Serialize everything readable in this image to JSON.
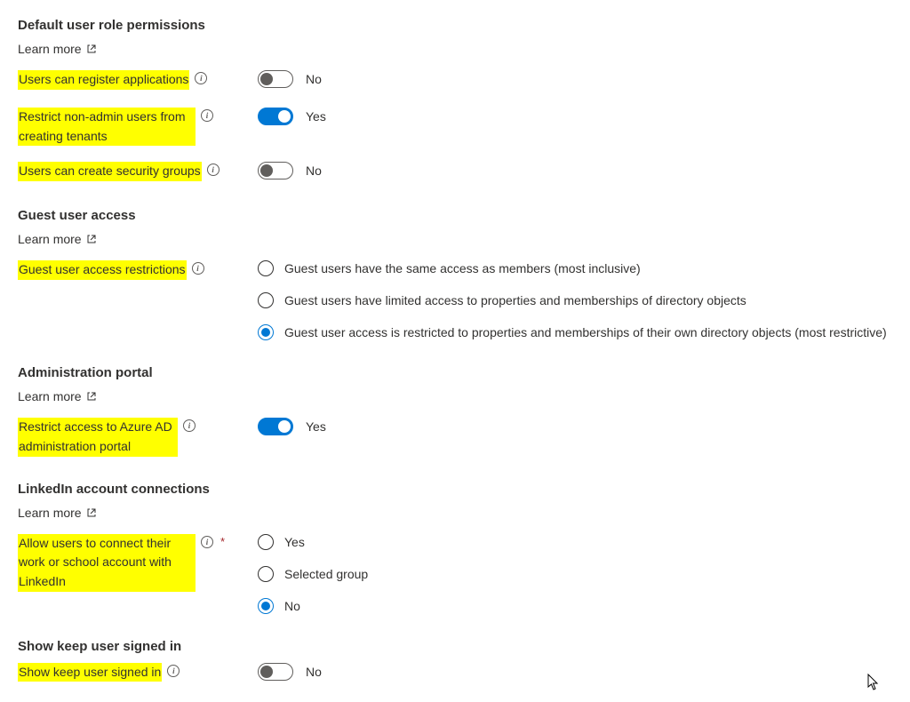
{
  "sections": {
    "default_role": {
      "title": "Default user role permissions",
      "learn_more": "Learn more",
      "settings": {
        "register_apps": {
          "label": "Users can register applications",
          "value": "No",
          "on": false
        },
        "restrict_tenants": {
          "label": "Restrict non-admin users from creating tenants",
          "value": "Yes",
          "on": true
        },
        "security_groups": {
          "label": "Users can create security groups",
          "value": "No",
          "on": false
        }
      }
    },
    "guest_access": {
      "title": "Guest user access",
      "learn_more": "Learn more",
      "label": "Guest user access restrictions",
      "options": [
        "Guest users have the same access as members (most inclusive)",
        "Guest users have limited access to properties and memberships of directory objects",
        "Guest user access is restricted to properties and memberships of their own directory objects (most restrictive)"
      ],
      "selected": 2
    },
    "admin_portal": {
      "title": "Administration portal",
      "learn_more": "Learn more",
      "settings": {
        "restrict_portal": {
          "label": "Restrict access to Azure AD administration portal",
          "value": "Yes",
          "on": true
        }
      }
    },
    "linkedin": {
      "title": "LinkedIn account connections",
      "learn_more": "Learn more",
      "label": "Allow users to connect their work or school account with LinkedIn",
      "required": true,
      "options": [
        "Yes",
        "Selected group",
        "No"
      ],
      "selected": 2
    },
    "keep_signed_in": {
      "title": "Show keep user signed in",
      "label": "Show keep user signed in",
      "value": "No",
      "on": false
    }
  }
}
